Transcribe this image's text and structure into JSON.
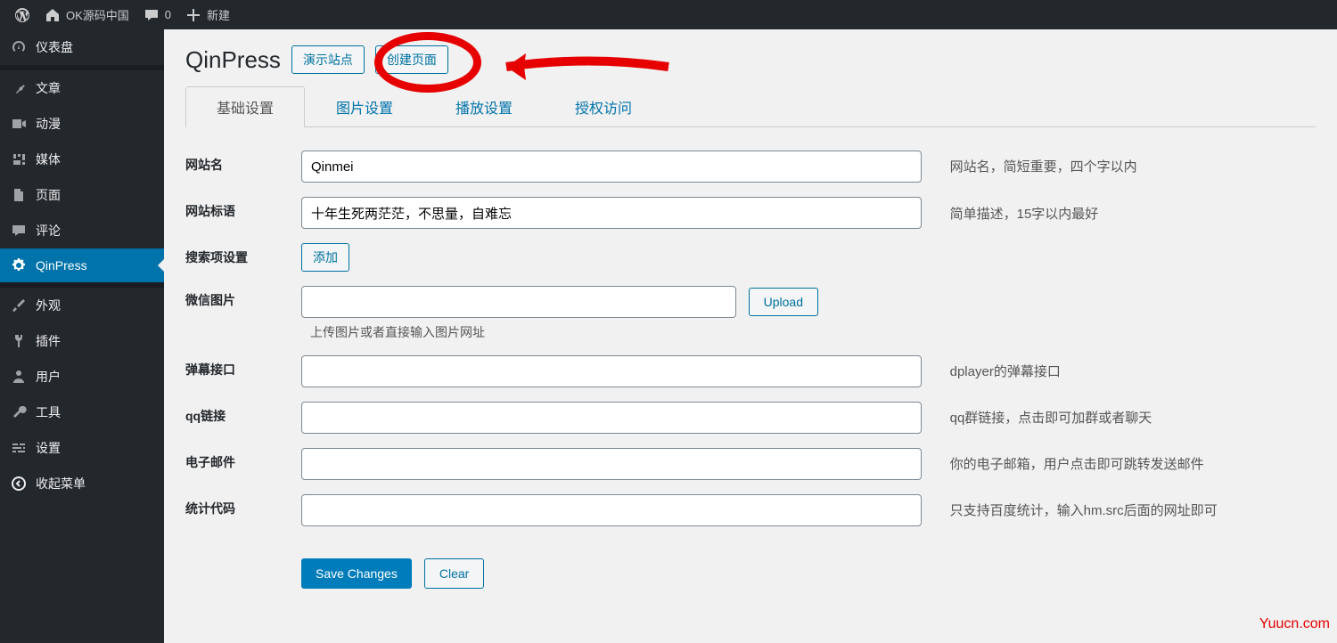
{
  "topbar": {
    "site": "OK源码中国",
    "comments": "0",
    "new": "新建"
  },
  "sidebar": {
    "items": [
      {
        "icon": "dashboard",
        "label": "仪表盘"
      },
      {
        "icon": "pin",
        "label": "文章"
      },
      {
        "icon": "video",
        "label": "动漫"
      },
      {
        "icon": "media",
        "label": "媒体"
      },
      {
        "icon": "page",
        "label": "页面"
      },
      {
        "icon": "comment",
        "label": "评论"
      },
      {
        "icon": "gear",
        "label": "QinPress",
        "active": true
      },
      {
        "icon": "brush",
        "label": "外观"
      },
      {
        "icon": "plug",
        "label": "插件"
      },
      {
        "icon": "user",
        "label": "用户"
      },
      {
        "icon": "wrench",
        "label": "工具"
      },
      {
        "icon": "sliders",
        "label": "设置"
      },
      {
        "icon": "collapse",
        "label": "收起菜单"
      }
    ]
  },
  "page": {
    "title": "QinPress",
    "buttons": {
      "demo": "演示站点",
      "create": "创建页面"
    }
  },
  "tabs": [
    {
      "label": "基础设置",
      "active": true
    },
    {
      "label": "图片设置"
    },
    {
      "label": "播放设置"
    },
    {
      "label": "授权访问"
    }
  ],
  "form": {
    "siteName": {
      "label": "网站名",
      "value": "Qinmei",
      "desc": "网站名，简短重要，四个字以内"
    },
    "slogan": {
      "label": "网站标语",
      "value": "十年生死两茫茫，不思量，自难忘",
      "desc": "简单描述，15字以内最好"
    },
    "search": {
      "label": "搜索项设置",
      "button": "添加"
    },
    "wechat": {
      "label": "微信图片",
      "value": "",
      "upload": "Upload",
      "hint": "上传图片或者直接输入图片网址"
    },
    "danmaku": {
      "label": "弹幕接口",
      "value": "",
      "desc": "dplayer的弹幕接口"
    },
    "qq": {
      "label": "qq链接",
      "value": "",
      "desc": "qq群链接，点击即可加群或者聊天"
    },
    "email": {
      "label": "电子邮件",
      "value": "",
      "desc": "你的电子邮箱，用户点击即可跳转发送邮件"
    },
    "stats": {
      "label": "统计代码",
      "value": "",
      "desc": "只支持百度统计，输入hm.src后面的网址即可"
    }
  },
  "actions": {
    "save": "Save Changes",
    "clear": "Clear"
  },
  "watermark": "Yuucn.com"
}
